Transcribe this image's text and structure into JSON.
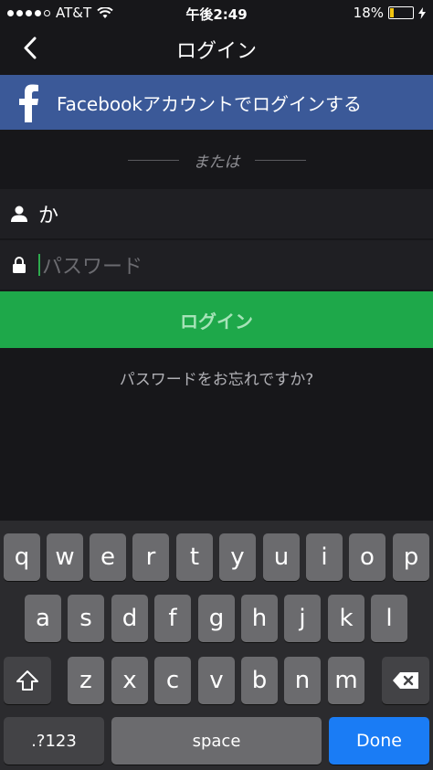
{
  "status_bar": {
    "carrier": "AT&T",
    "time": "午後2:49",
    "battery": "18%",
    "battery_level": 0.18
  },
  "nav": {
    "title": "ログイン"
  },
  "facebook_button": {
    "label": "Facebookアカウントでログインする",
    "color": "#3b5998"
  },
  "divider": {
    "text": "または"
  },
  "username_field": {
    "value": "か"
  },
  "password_field": {
    "placeholder": "パスワード"
  },
  "login_button": {
    "label": "ログイン",
    "color": "#1ea84a"
  },
  "forgot_link": {
    "label": "パスワードをお忘れですか?"
  },
  "keyboard": {
    "row1": [
      "q",
      "w",
      "e",
      "r",
      "t",
      "y",
      "u",
      "i",
      "o",
      "p"
    ],
    "row2": [
      "a",
      "s",
      "d",
      "f",
      "g",
      "h",
      "j",
      "k",
      "l"
    ],
    "row3": [
      "z",
      "x",
      "c",
      "v",
      "b",
      "n",
      "m"
    ],
    "numbers_label": ".?123",
    "space_label": "space",
    "done_label": "Done"
  }
}
